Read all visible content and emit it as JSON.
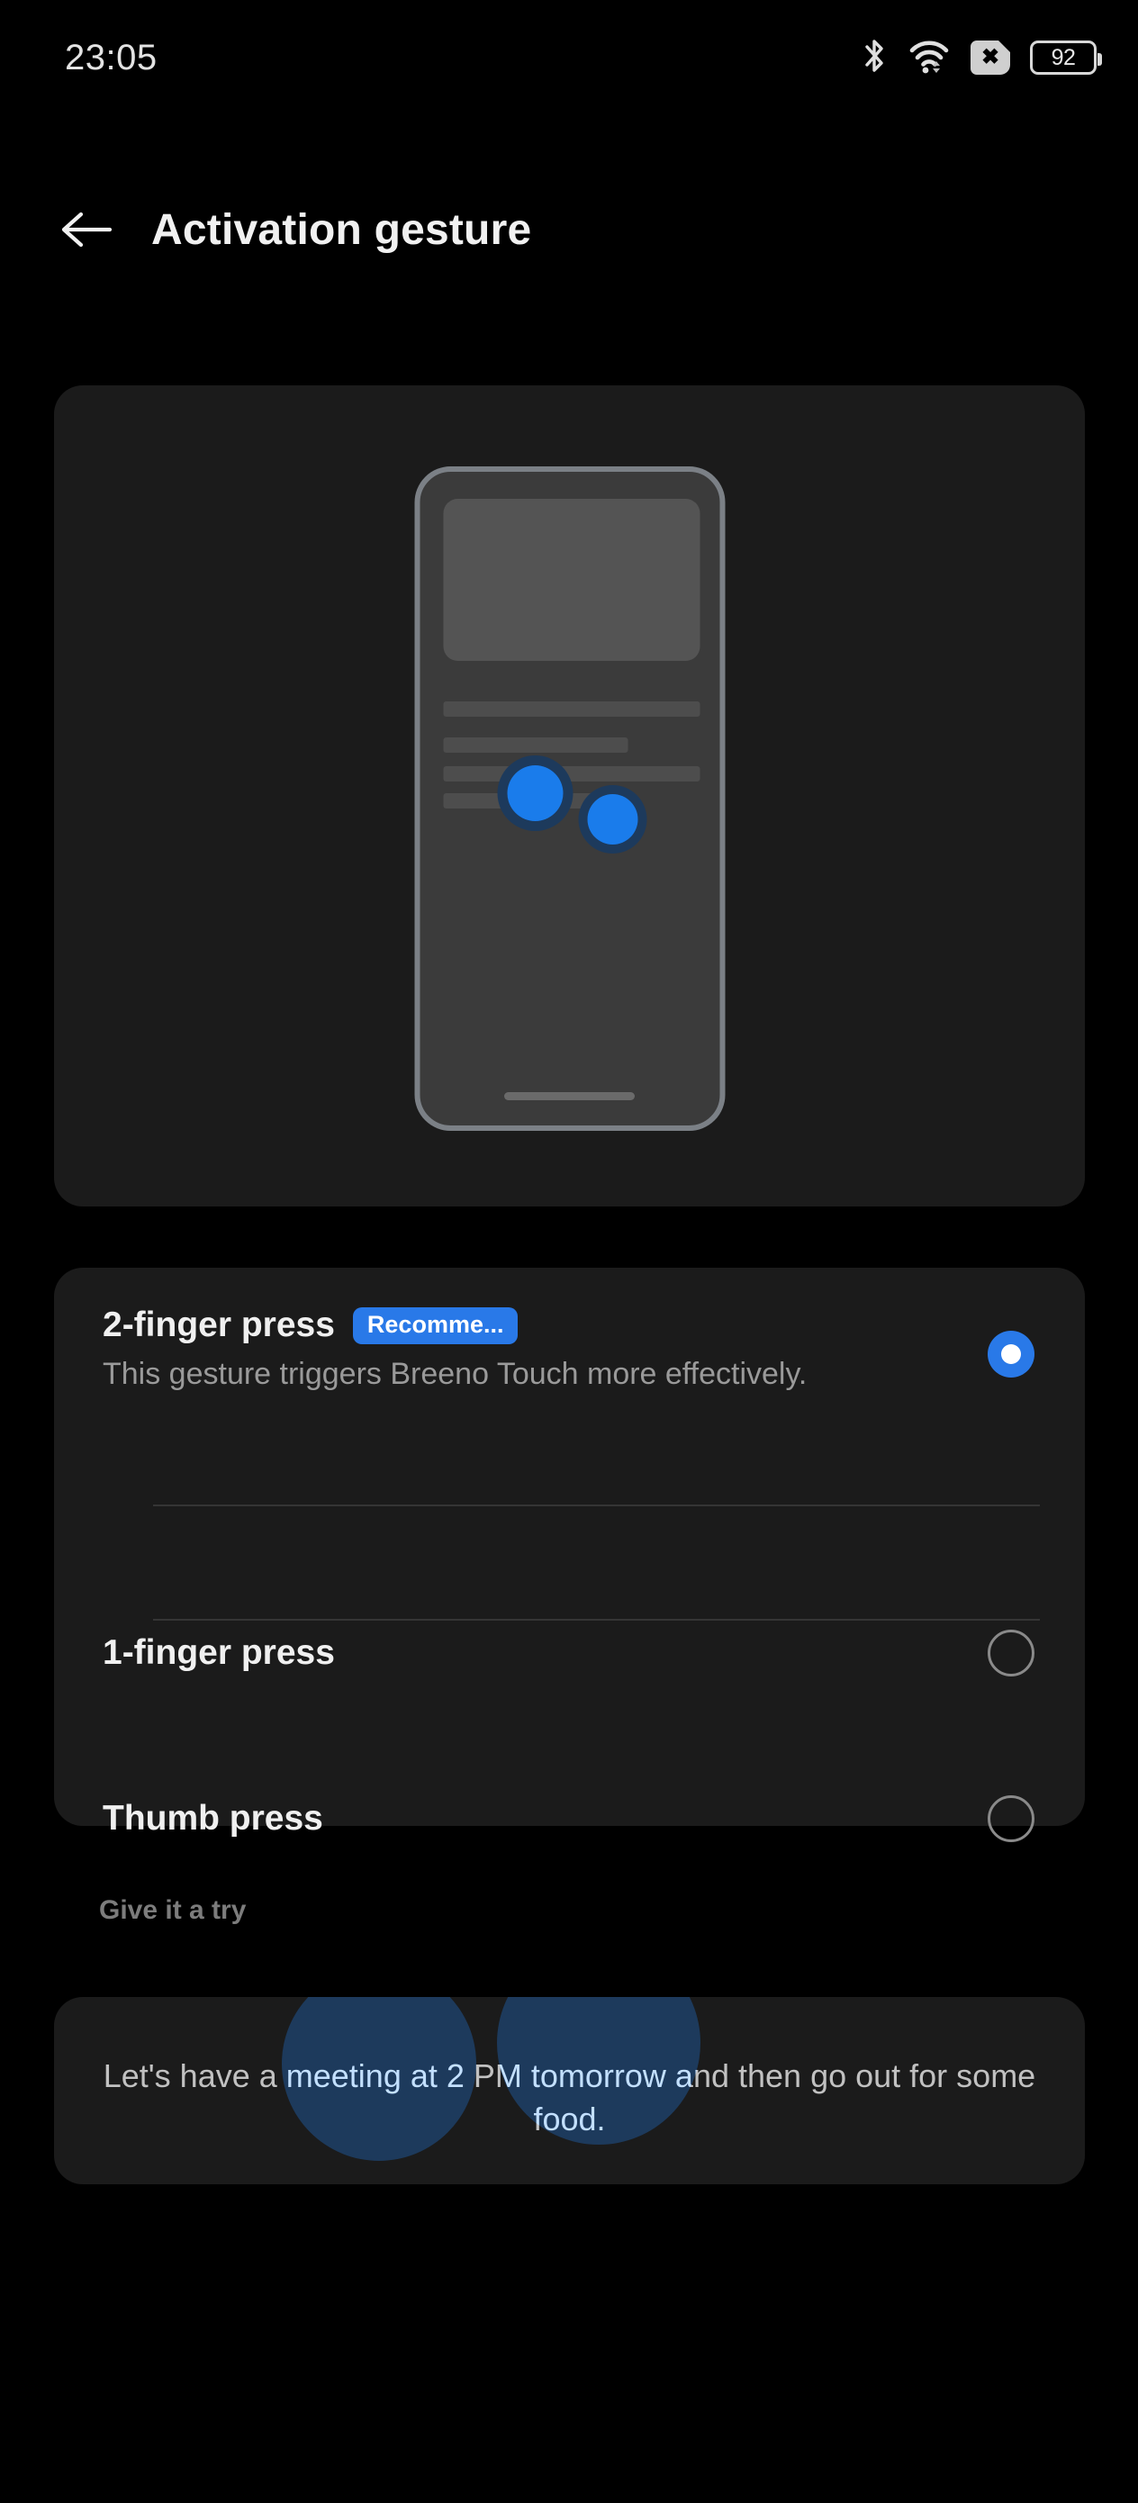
{
  "status_bar": {
    "time": "23:05",
    "battery_level": "92",
    "icons": [
      "bluetooth-icon",
      "wifi-icon",
      "sim-card-disabled-icon",
      "battery-icon"
    ]
  },
  "header": {
    "back_icon": "back-arrow-icon",
    "title": "Activation gesture"
  },
  "illustration": {
    "name": "gesture-demo-phone-illustration",
    "touch_points": 2
  },
  "options": [
    {
      "title": "2-finger press",
      "badge": "Recomme...",
      "description": "This gesture triggers Breeno Touch more effectively.",
      "selected": true
    },
    {
      "title": "1-finger press",
      "badge": "",
      "description": "",
      "selected": false
    },
    {
      "title": "Thumb press",
      "badge": "",
      "description": "",
      "selected": false
    }
  ],
  "try_section": {
    "label": "Give it a try",
    "demo_text": "Let's have a meeting at 2 PM tomorrow and then go out for some food."
  },
  "colors": {
    "background": "#000000",
    "card": "#1b1b1b",
    "accent": "#2979e8",
    "touch_halo": "#1d3a5c",
    "text_primary": "#f0f0f0",
    "text_secondary": "#9a9a9a"
  }
}
